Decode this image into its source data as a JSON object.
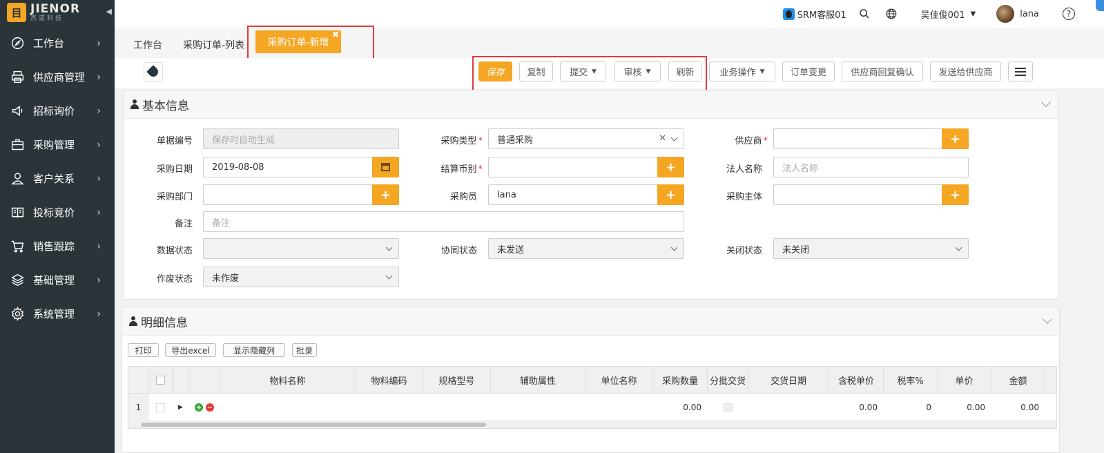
{
  "brand": {
    "logo_text": "JIENOR",
    "logo_subtext": "杰诺科技",
    "logo_mark": "目"
  },
  "sidebar": {
    "items": [
      {
        "label": "工作台",
        "icon": "compass-icon"
      },
      {
        "label": "供应商管理",
        "icon": "printer-icon"
      },
      {
        "label": "招标询价",
        "icon": "megaphone-icon"
      },
      {
        "label": "采购管理",
        "icon": "briefcase-icon"
      },
      {
        "label": "客户关系",
        "icon": "user-icon"
      },
      {
        "label": "投标竞价",
        "icon": "book-icon"
      },
      {
        "label": "销售跟踪",
        "icon": "cart-icon"
      },
      {
        "label": "基础管理",
        "icon": "layers-icon"
      },
      {
        "label": "系统管理",
        "icon": "gear-icon"
      }
    ]
  },
  "topbar": {
    "service": "SRM客服01",
    "company": "吴佳俊001",
    "user": "lana",
    "help": "?"
  },
  "tabs": {
    "items": [
      "工作台",
      "采购订单-列表"
    ],
    "active": "采购订单-新增",
    "close": "✖"
  },
  "toolbar": {
    "save": "保存",
    "copy": "复制",
    "submit": "提交",
    "audit": "审核",
    "refresh": "刷新",
    "business": "业务操作",
    "change": "订单变更",
    "supplier_reply": "供应商回复确认",
    "send_supplier": "发送给供应商"
  },
  "basic": {
    "title": "基本信息",
    "doc_no_label": "单据编号",
    "doc_no_placeholder": "保存时自动生成",
    "purchase_type_label": "采购类型",
    "purchase_type_value": "普通采购",
    "supplier_label": "供应商",
    "purchase_date_label": "采购日期",
    "purchase_date_value": "2019-08-08",
    "currency_label": "结算币别",
    "legal_name_label": "法人名称",
    "legal_name_placeholder": "法人名称",
    "dept_label": "采购部门",
    "buyer_label": "采购员",
    "buyer_value": "lana",
    "subject_label": "采购主体",
    "remark_label": "备注",
    "remark_placeholder": "备注",
    "data_status_label": "数据状态",
    "coop_status_label": "协同状态",
    "coop_status_value": "未发送",
    "close_status_label": "关闭状态",
    "close_status_value": "未关闭",
    "void_status_label": "作废状态",
    "void_status_value": "未作废"
  },
  "detail": {
    "title": "明细信息",
    "tools": [
      "打印",
      "导出excel",
      "显示隐藏列",
      "批录"
    ],
    "columns": [
      "物料名称",
      "物料编码",
      "规格型号",
      "辅助属性",
      "单位名称",
      "采购数量",
      "分批交货",
      "交货日期",
      "含税单价",
      "税率%",
      "单价",
      "金额"
    ],
    "row": {
      "index": "1",
      "qty": "0.00",
      "tax_price": "0.00",
      "tax_rate": "0",
      "price": "0.00",
      "amount": "0.00"
    }
  }
}
